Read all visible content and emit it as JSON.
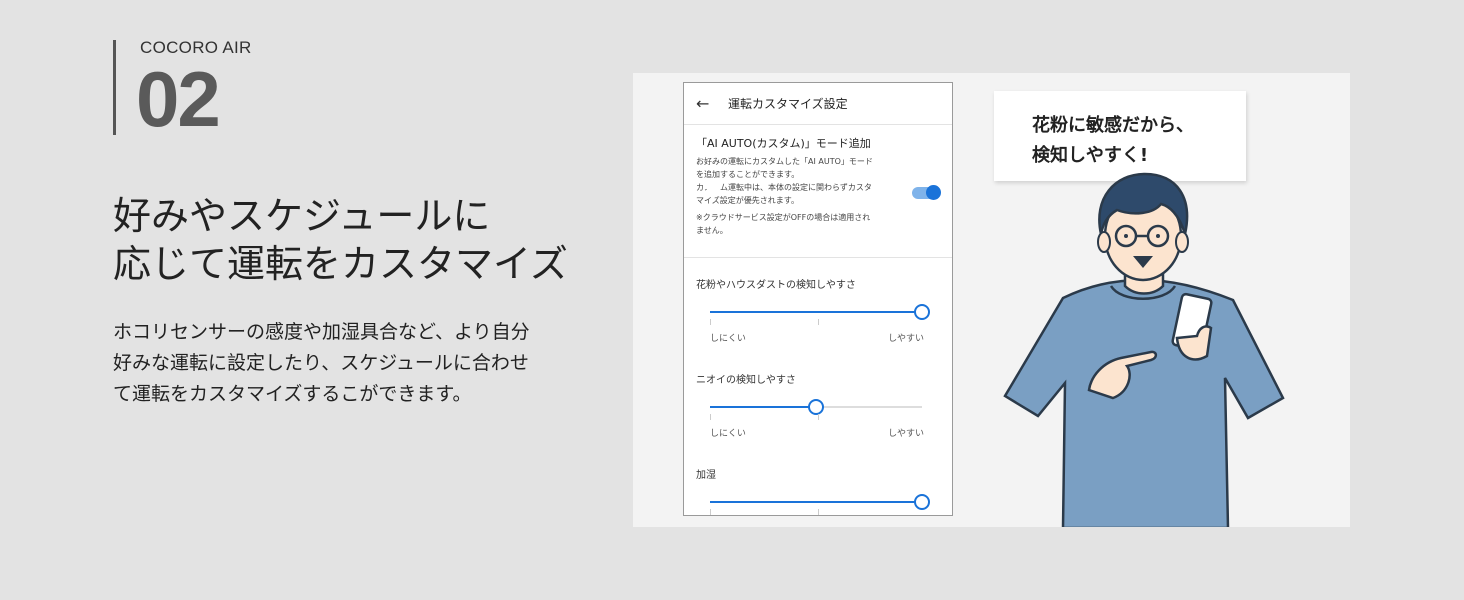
{
  "hero": {
    "brand": "COCORO AIR",
    "number": "02",
    "headline_line1": "好みやスケジュールに",
    "headline_line2": "応じて運転をカスタマイズ",
    "desc_line1": "ホコリセンサーの感度や加湿具合など、より自分",
    "desc_line2": "好みな運転に設定したり、スケジュールに合わせ",
    "desc_line3": "て運転をカスタマイズするこができます。"
  },
  "app": {
    "back_icon": "arrow-left-icon",
    "title": "運転カスタマイズ設定",
    "mode_title": "「AI AUTO(カスタム)」モード追加",
    "mode_desc_1": "お好みの運転にカスタムした「AI AUTO」モード",
    "mode_desc_2": "を追加することができます。",
    "mode_desc_3": "カスタム運転中は、本体の設定に関わらずカスタ",
    "mode_desc_4": "マイズ設定が優先されます。",
    "mode_note_1": "※クラウドサービス設定がOFFの場合は適用され",
    "mode_note_2": "ません。",
    "toggle_on": true,
    "accent_color": "#1a73d9",
    "sliders": [
      {
        "label": "花粉やハウスダストの検知しやすさ",
        "min_label": "しにくい",
        "max_label": "しやすい",
        "level": 1.0
      },
      {
        "label": "ニオイの検知しやすさ",
        "min_label": "しにくい",
        "max_label": "しやすい",
        "level": 0.5
      },
      {
        "label": "加湿",
        "min_label": "",
        "max_label": "",
        "level": 1.0
      }
    ]
  },
  "bubble": {
    "line1": "花粉に敏感だから、",
    "line2": "検知しやすく!"
  }
}
